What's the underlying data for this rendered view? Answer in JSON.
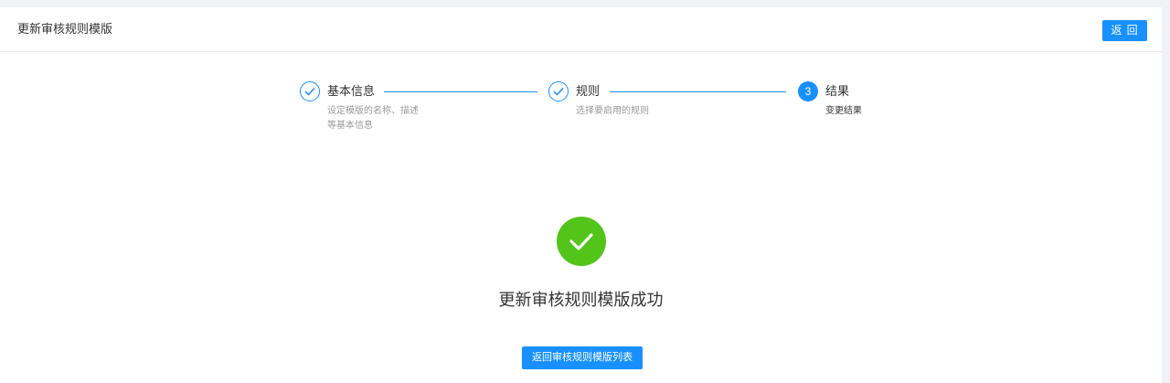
{
  "header": {
    "title": "更新审核规则模版",
    "back_label": "返 回"
  },
  "steps": [
    {
      "status": "finished",
      "title": "基本信息",
      "description_lines": [
        "设定模版的名称、描述",
        "等基本信息"
      ]
    },
    {
      "status": "finished",
      "title": "规则",
      "description_lines": [
        "选择要启用的规则"
      ]
    },
    {
      "status": "current",
      "number": "3",
      "title": "结果",
      "description_lines": [
        "变更结果"
      ]
    }
  ],
  "result": {
    "status": "success",
    "title": "更新审核规则模版成功",
    "button_label": "返回审核规则模版列表"
  },
  "colors": {
    "primary": "#1890ff",
    "success": "#52c41a"
  }
}
